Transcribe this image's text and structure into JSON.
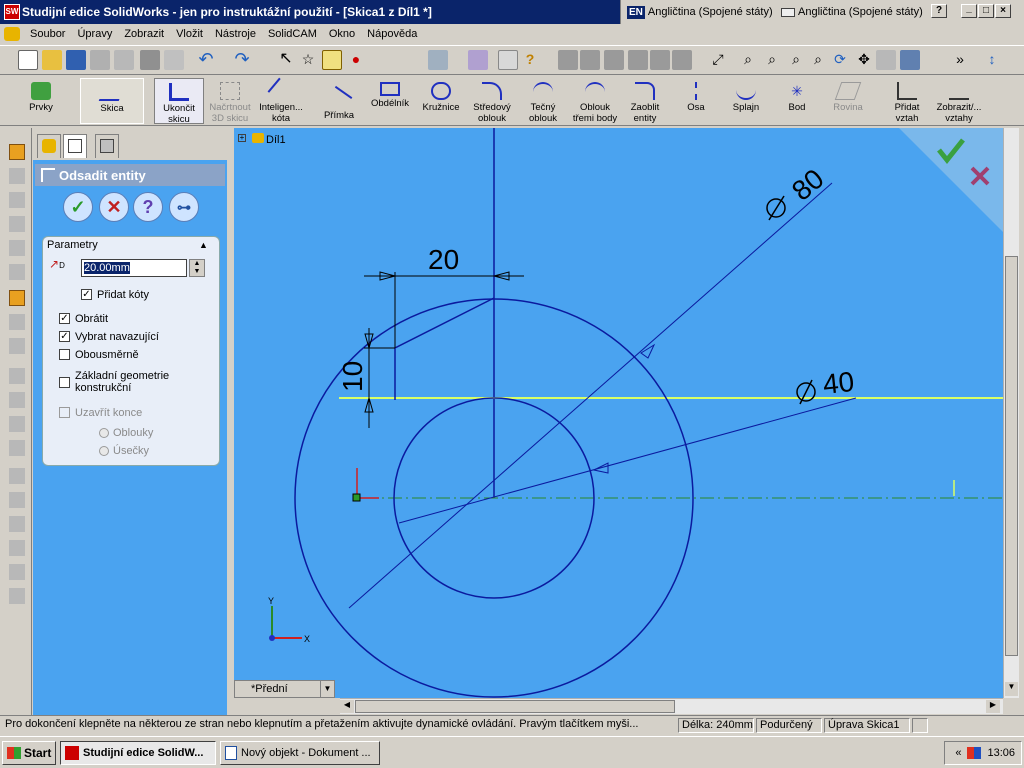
{
  "window": {
    "title": "Studijní edice SolidWorks - jen pro instruktážní použití - [Skica1 z Díl1 *]",
    "lang_badge": "EN",
    "lang_left": "Angličtina (Spojené státy)",
    "lang_right": "Angličtina (Spojené státy)",
    "help": "?"
  },
  "menu": [
    "Soubor",
    "Úpravy",
    "Zobrazit",
    "Vložit",
    "Nástroje",
    "SolidCAM",
    "Okno",
    "Nápověda"
  ],
  "sketch_toolbar": {
    "features": "Prvky",
    "sketch": "Skica",
    "exit_sketch": "Ukončit skicu",
    "sketch_3d": "Načrtnout 3D skicu",
    "smart_dim": "Inteligen... kóta",
    "line": "Přímka",
    "rectangle": "Obdélník",
    "circle": "Kružnice",
    "center_arc": "Středový oblouk",
    "tangent_arc": "Tečný oblouk",
    "three_point_arc": "Oblouk třemi body",
    "fillet": "Zaoblit entity",
    "centerline": "Osa",
    "spline": "Splajn",
    "point": "Bod",
    "plane": "Rovina",
    "add_relation": "Přidat vztah",
    "show_relations": "Zobrazit/... vztahy"
  },
  "property_manager": {
    "title": "Odsadit entity",
    "group_title": "Parametry",
    "offset_value": "20.00mm",
    "add_dims": "Přidat kóty",
    "reverse": "Obrátit",
    "select_chain": "Vybrat navazující",
    "bidirectional": "Obousměrně",
    "base_construction": "Základní geometrie konstrukční",
    "cap_ends": "Uzavřít konce",
    "arcs": "Oblouky",
    "lines": "Úsečky"
  },
  "canvas": {
    "tree_item": "Díl1",
    "view": "*Přední",
    "dim_80": "80",
    "dim_40": "40",
    "dim_20": "20",
    "dim_10": "10",
    "axis_y": "Y",
    "axis_x": "X"
  },
  "status": {
    "message": "Pro dokončení klepněte na některou ze stran nebo klepnutím a přetažením aktivujte dynamické ovládání.  Pravým tlačítkem myši...",
    "length": "Délka: 240mm",
    "state": "Podurčený",
    "mode": "Úprava Skica1"
  },
  "taskbar": {
    "start": "Start",
    "task1": "Studijní edice SolidW...",
    "task2": "Nový objekt - Dokument ...",
    "tray_arrows": "«",
    "time": "13:06"
  },
  "colors": {
    "canvas": "#4aa3f0",
    "sketch_line": "#0b1a9e",
    "highlight": "#d9ff66",
    "titlebar": "#0a246a"
  }
}
